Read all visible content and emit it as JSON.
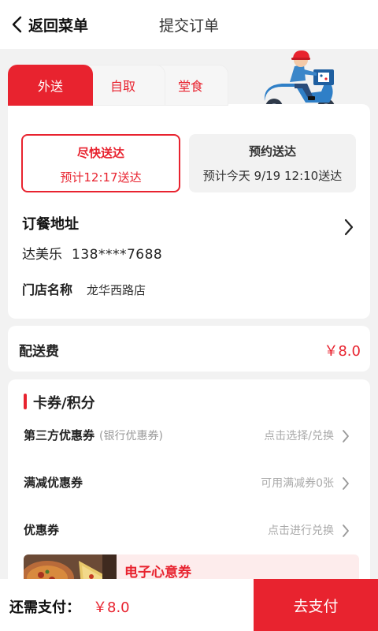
{
  "header": {
    "back_label": "返回菜单",
    "title": "提交订单"
  },
  "tabs": [
    "外送",
    "自取",
    "堂食"
  ],
  "delivery_options": {
    "fast": {
      "title": "尽快送达",
      "subtitle": "预计12:17送达"
    },
    "reserve": {
      "title": "预约送达",
      "subtitle": "预计今天 9/19 12:10送达"
    }
  },
  "address": {
    "title": "订餐地址",
    "name": "达美乐",
    "phone": "138****7688",
    "store_label": "门店名称",
    "store_name": "龙华西路店"
  },
  "fee": {
    "label": "配送费",
    "value": "￥8.0"
  },
  "coupons": {
    "section_title": "卡券/积分",
    "rows": [
      {
        "label": "第三方优惠券",
        "sub": "(银行优惠券)",
        "action": "点击选择/兑换"
      },
      {
        "label": "满减优惠券",
        "sub": "",
        "action": "可用满减券0张"
      },
      {
        "label": "优惠券",
        "sub": "",
        "action": "点击进行兑换"
      }
    ],
    "ecard_label": "电子心意券"
  },
  "footer": {
    "due_label": "还需支付：",
    "due_value": "￥8.0",
    "pay_label": "去支付"
  },
  "colors": {
    "accent": "#e8232f",
    "background": "#f2f2f2"
  }
}
